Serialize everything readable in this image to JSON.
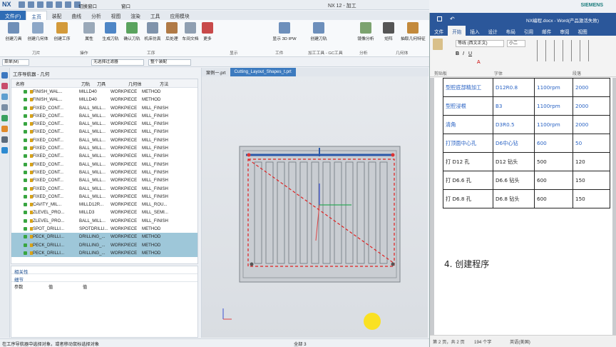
{
  "nx": {
    "logo": "NX",
    "switch_window": "切换窗口",
    "window_menu": "窗口",
    "title": "NX 12 - 加工",
    "tabs": [
      "文件(F)",
      "主页",
      "装配",
      "曲线",
      "分析",
      "视图",
      "渲染",
      "工具",
      "应用模块"
    ],
    "ribbon_buttons": [
      "创建刀具",
      "创建几何体",
      "创建工序",
      "属性",
      "生成刀轨",
      "确认刀轨",
      "机床仿真",
      "后处理",
      "车间文档",
      "更多",
      "显示 3D IPW",
      "创建刀轨",
      "镜像分析",
      "矩阵",
      "抽取几何特征"
    ],
    "ribbon_groups": [
      "刀片",
      "操作",
      "工序",
      "显示",
      "工件",
      "加工工具 - GC工具",
      "分析",
      "几何体"
    ],
    "filter_menu": "菜单(M)",
    "filter_select": "无选择过滤器",
    "filter_assembly": "整个装配"
  },
  "navigator": {
    "title": "工序导航器 - 几何",
    "columns": [
      "名称",
      "刀轨",
      "刀具",
      "几何体",
      "方法"
    ],
    "rows": [
      {
        "name": "FINISH_WAL...",
        "tool": "MILLD40",
        "geo": "WORKPIECE",
        "method": "METHOD"
      },
      {
        "name": "FINISH_WAL...",
        "tool": "MILLD40",
        "geo": "WORKPIECE",
        "method": "METHOD"
      },
      {
        "name": "FIXED_CONT...",
        "tool": "BALL_MILL...",
        "geo": "WORKPIECE",
        "method": "MILL_FINISH"
      },
      {
        "name": "FIXED_CONT...",
        "tool": "BALL_MILL...",
        "geo": "WORKPIECE",
        "method": "MILL_FINISH"
      },
      {
        "name": "FIXED_CONT...",
        "tool": "BALL_MILL...",
        "geo": "WORKPIECE",
        "method": "MILL_FINISH"
      },
      {
        "name": "FIXED_CONT...",
        "tool": "BALL_MILL...",
        "geo": "WORKPIECE",
        "method": "MILL_FINISH"
      },
      {
        "name": "FIXED_CONT...",
        "tool": "BALL_MILL...",
        "geo": "WORKPIECE",
        "method": "MILL_FINISH"
      },
      {
        "name": "FIXED_CONT...",
        "tool": "BALL_MILL...",
        "geo": "WORKPIECE",
        "method": "MILL_FINISH"
      },
      {
        "name": "FIXED_CONT...",
        "tool": "BALL_MILL...",
        "geo": "WORKPIECE",
        "method": "MILL_FINISH"
      },
      {
        "name": "FIXED_CONT...",
        "tool": "BALL_MILL...",
        "geo": "WORKPIECE",
        "method": "MILL_FINISH"
      },
      {
        "name": "FIXED_CONT...",
        "tool": "BALL_MILL...",
        "geo": "WORKPIECE",
        "method": "MILL_FINISH"
      },
      {
        "name": "FIXED_CONT...",
        "tool": "BALL_MILL...",
        "geo": "WORKPIECE",
        "method": "MILL_FINISH"
      },
      {
        "name": "FIXED_CONT...",
        "tool": "BALL_MILL...",
        "geo": "WORKPIECE",
        "method": "MILL_FINISH"
      },
      {
        "name": "FIXED_CONT...",
        "tool": "BALL_MILL...",
        "geo": "WORKPIECE",
        "method": "MILL_FINISH"
      },
      {
        "name": "CAVITY_MIL...",
        "tool": "MILLD12R...",
        "geo": "WORKPIECE",
        "method": "MILL_ROU..."
      },
      {
        "name": "ZLEVEL_PRO...",
        "tool": "MILLD3",
        "geo": "WORKPIECE",
        "method": "MILL_SEMI..."
      },
      {
        "name": "ZLEVEL_PRO...",
        "tool": "BALL_MILL...",
        "geo": "WORKPIECE",
        "method": "MILL_FINISH"
      },
      {
        "name": "SPOT_DRILLI...",
        "tool": "SPOTDRILLI...",
        "geo": "WORKPIECE",
        "method": "METHOD"
      },
      {
        "name": "PECK_DRILLI...",
        "tool": "DRILLING_...",
        "geo": "WORKPIECE",
        "method": "METHOD"
      },
      {
        "name": "PECK_DRILLI...",
        "tool": "DRILLING_...",
        "geo": "WORKPIECE",
        "method": "METHOD"
      },
      {
        "name": "PECK_DRILLI...",
        "tool": "DRILLING_...",
        "geo": "WORKPIECE",
        "method": "METHOD"
      }
    ]
  },
  "details": {
    "dependencies": "相关性",
    "details": "细节",
    "param": "参数",
    "value": "值",
    "value2": "值"
  },
  "viewport": {
    "tab1": "案例一.prt",
    "tab2": "Cutting_Layout_Shapes_t.prt"
  },
  "status": {
    "left": "在工序导航器中选择对象，或者移动鼠标选择对象",
    "mid": "全部 3"
  },
  "word": {
    "siemens": "SIEMENS",
    "title": "NX编程.docx - Word(产品激活失败)",
    "tabs": [
      "文件",
      "开始",
      "插入",
      "设计",
      "布局",
      "引用",
      "邮件",
      "审阅",
      "视图"
    ],
    "font_name": "等线 (西文正文)",
    "font_size": "小二",
    "groups": [
      "剪贴板",
      "字体",
      "段落"
    ],
    "table": [
      [
        "型腔底部精加工",
        "D12R0.8",
        "1100rpm",
        "2000"
      ],
      [
        "型腔浸根",
        "B3",
        "1100rpm",
        "2000"
      ],
      [
        "清角",
        "D3R0.5",
        "1100rpm",
        "2000"
      ],
      [
        "打顶面中心孔",
        "D6中心钻",
        "600",
        "50"
      ],
      [
        "打 D12 孔",
        "D12 钻头",
        "500",
        "120"
      ],
      [
        "打 D6.6 孔",
        "D6.6 钻头",
        "600",
        "150"
      ],
      [
        "打 D6.8 孔",
        "D6.8 钻头",
        "600",
        "150"
      ]
    ],
    "heading": "4. 创建程序",
    "status_page": "第 2 页，共 2 页",
    "status_words": "194 个字",
    "status_lang": "英语(美国)"
  },
  "colors": {
    "nx_accent": "#2f6db5",
    "word_accent": "#2b579a",
    "row_selected": "#9ec7d9",
    "toolpath": "#e02020"
  }
}
